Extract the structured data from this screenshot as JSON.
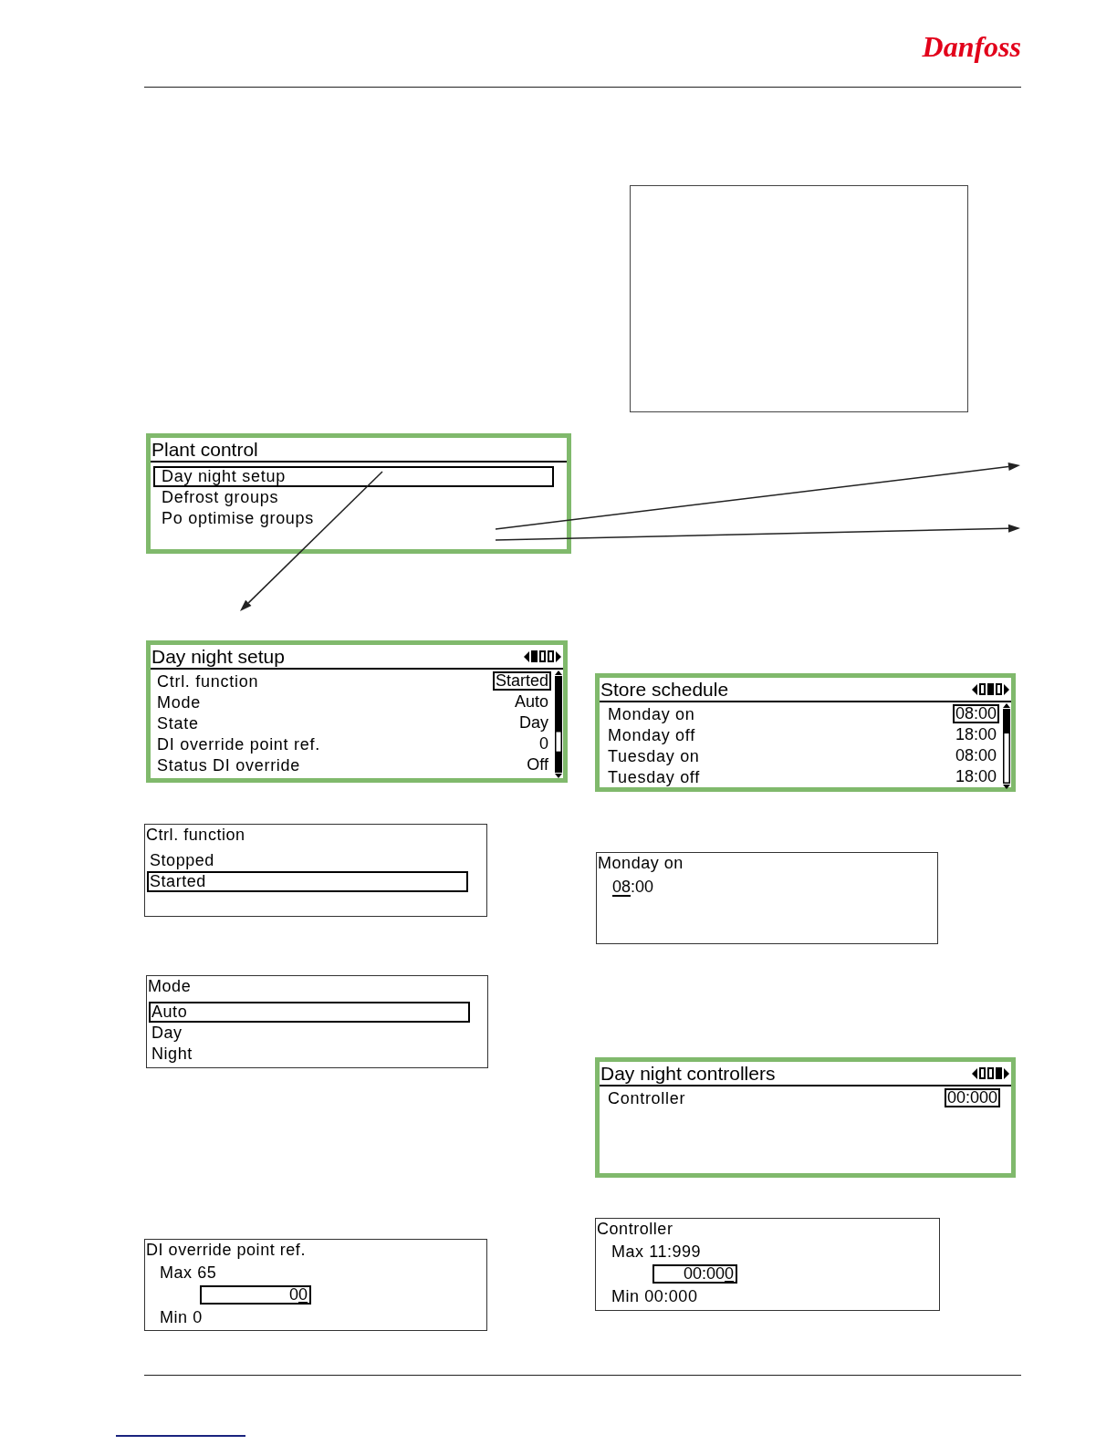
{
  "header": {
    "logo": "Danfoss"
  },
  "plant_control": {
    "title": "Plant control",
    "items": [
      {
        "label": "Day night setup",
        "selected": true
      },
      {
        "label": "Defrost groups",
        "selected": false
      },
      {
        "label": "Po optimise groups",
        "selected": false
      }
    ]
  },
  "day_night_setup": {
    "title": "Day night setup",
    "pages": [
      {
        "selected": true
      },
      {
        "selected": false
      },
      {
        "selected": false
      }
    ],
    "rows": [
      {
        "label": "Ctrl. function",
        "value": "Started",
        "selected": true
      },
      {
        "label": "Mode",
        "value": "Auto",
        "selected": false
      },
      {
        "label": "State",
        "value": "Day",
        "selected": false
      },
      {
        "label": "DI override point ref.",
        "value": "0",
        "selected": false
      },
      {
        "label": "Status DI override",
        "value": "Off",
        "selected": false
      }
    ]
  },
  "ctrl_function_dialog": {
    "title": "Ctrl. function",
    "options": [
      {
        "label": "Stopped",
        "selected": false
      },
      {
        "label": "Started",
        "selected": true
      }
    ]
  },
  "mode_dialog": {
    "title": "Mode",
    "options": [
      {
        "label": "Auto",
        "selected": true
      },
      {
        "label": "Day",
        "selected": false
      },
      {
        "label": "Night",
        "selected": false
      }
    ]
  },
  "di_override_dialog": {
    "title": "DI override point ref.",
    "max": "Max 65",
    "value": "00",
    "cursor_at_end": true,
    "min": "Min 0"
  },
  "store_schedule": {
    "title": "Store schedule",
    "pages": [
      {
        "selected": false
      },
      {
        "selected": true
      },
      {
        "selected": false
      }
    ],
    "rows": [
      {
        "label": "Monday on",
        "value": "08:00",
        "selected": true
      },
      {
        "label": "Monday off",
        "value": "18:00",
        "selected": false
      },
      {
        "label": "Tuesday on",
        "value": "08:00",
        "selected": false
      },
      {
        "label": "Tuesday off",
        "value": "18:00",
        "selected": false
      }
    ]
  },
  "monday_on_dialog": {
    "title": "Monday on",
    "value": "08:00",
    "cursor_at_end": false
  },
  "day_night_controllers": {
    "title": "Day night controllers",
    "pages": [
      {
        "selected": false
      },
      {
        "selected": false
      },
      {
        "selected": true
      }
    ],
    "rows": [
      {
        "label": "Controller",
        "value": "00:000",
        "selected": true
      }
    ]
  },
  "controller_dialog": {
    "title": "Controller",
    "max": "Max 11:999",
    "value": "00:000",
    "cursor_at_end": true,
    "min": "Min 00:000"
  }
}
